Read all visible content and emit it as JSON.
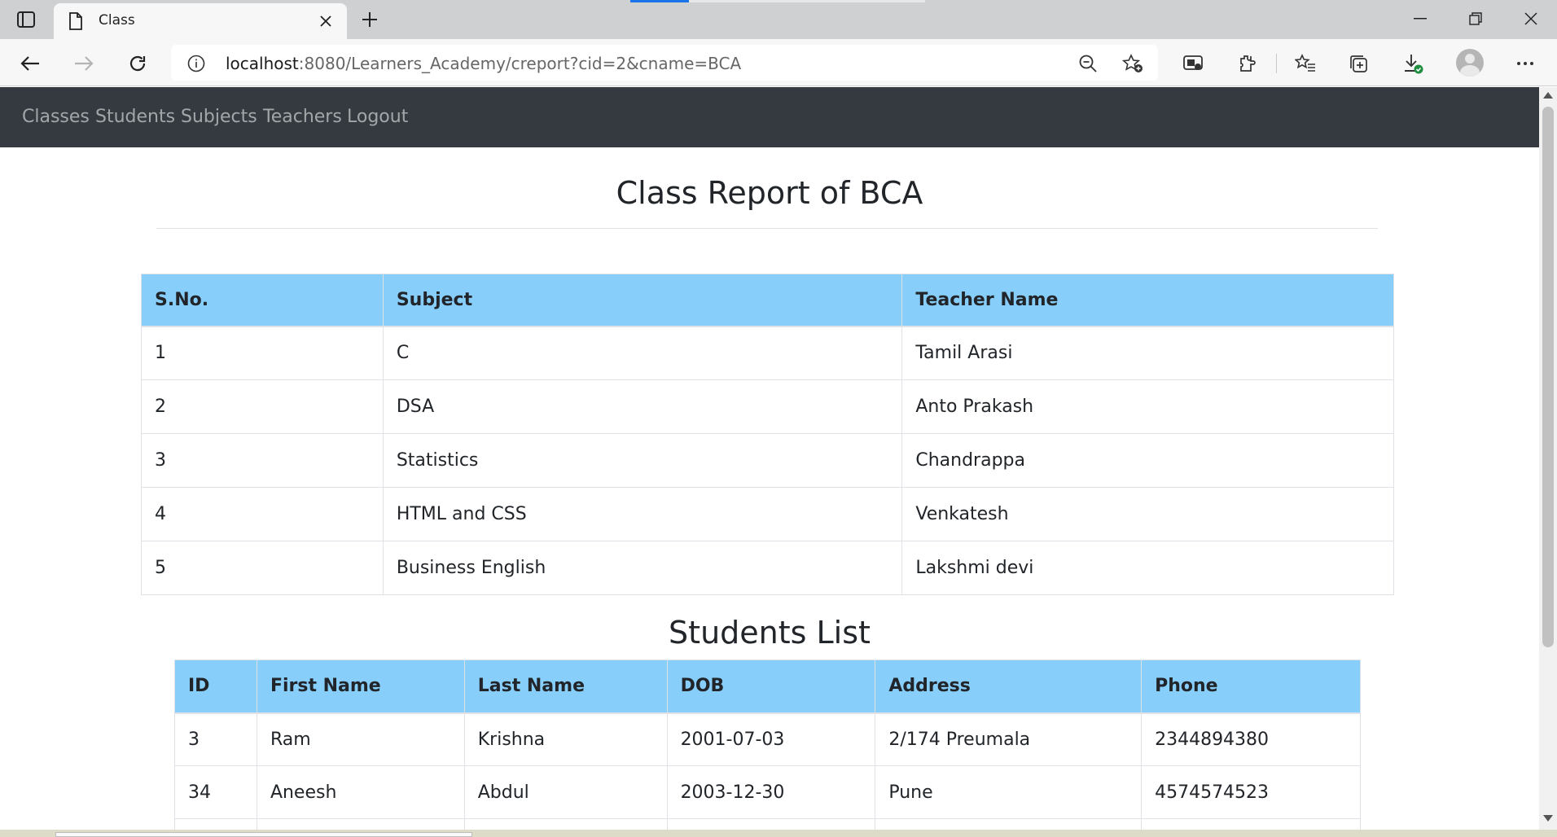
{
  "browser": {
    "tab_title": "Class",
    "url_host": "localhost",
    "url_rest": ":8080/Learners_Academy/creport?cid=2&cname=BCA"
  },
  "navbar": {
    "links": [
      "Classes",
      "Students",
      "Subjects",
      "Teachers",
      "Logout"
    ]
  },
  "report": {
    "title": "Class Report of BCA",
    "subjects_table": {
      "headers": [
        "S.No.",
        "Subject",
        "Teacher Name"
      ],
      "rows": [
        [
          "1",
          "C",
          "Tamil Arasi"
        ],
        [
          "2",
          "DSA",
          "Anto Prakash"
        ],
        [
          "3",
          "Statistics",
          "Chandrappa"
        ],
        [
          "4",
          "HTML and CSS",
          "Venkatesh"
        ],
        [
          "5",
          "Business English",
          "Lakshmi devi"
        ]
      ]
    },
    "students_title": "Students List",
    "students_table": {
      "headers": [
        "ID",
        "First Name",
        "Last Name",
        "DOB",
        "Address",
        "Phone"
      ],
      "rows": [
        [
          "3",
          "Ram",
          "Krishna",
          "2001-07-03",
          "2/174 Preumala",
          "2344894380"
        ],
        [
          "34",
          "Aneesh",
          "Abdul",
          "2003-12-30",
          "Pune",
          "4574574523"
        ],
        [
          "",
          "",
          "",
          "",
          "",
          ""
        ]
      ]
    }
  },
  "colors": {
    "navbar_bg": "#343a40",
    "table_header_bg": "#87cefa"
  }
}
